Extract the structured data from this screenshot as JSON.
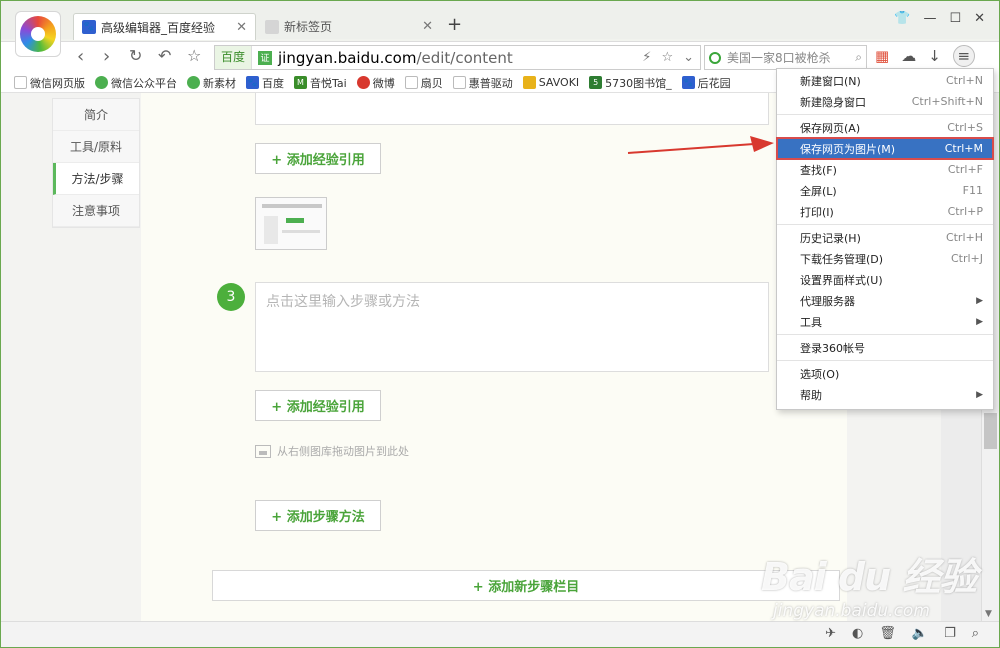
{
  "tabs": [
    {
      "title": "高级编辑器_百度经验",
      "active": true
    },
    {
      "title": "新标签页",
      "active": false
    }
  ],
  "address": {
    "tag": "百度",
    "badge": "证",
    "domain": "jingyan.baidu.com",
    "path": "/edit/content"
  },
  "search": {
    "text": "美国一家8口被枪杀"
  },
  "bookmarks": [
    {
      "label": "微信网页版",
      "icon": "page-icon",
      "color": "#bdbdbd"
    },
    {
      "label": "微信公众平台",
      "icon": "wechat-icon",
      "color": "#4caf50"
    },
    {
      "label": "新素材",
      "icon": "wechat-icon",
      "color": "#4caf50"
    },
    {
      "label": "百度",
      "icon": "baidu-paw-icon",
      "color": "#2f5fcf"
    },
    {
      "label": "音悦Tai",
      "icon": "yinyuetai-icon",
      "color": "#3a8d2a"
    },
    {
      "label": "微博",
      "icon": "weibo-icon",
      "color": "#d8382e"
    },
    {
      "label": "扇贝",
      "icon": "page-icon",
      "color": "#bdbdbd"
    },
    {
      "label": "惠普驱动",
      "icon": "page-icon",
      "color": "#bdbdbd"
    },
    {
      "label": "SAVOKI",
      "icon": "savoki-icon",
      "color": "#e8b21a"
    },
    {
      "label": "5730图书馆_",
      "icon": "five-icon",
      "color": "#2e7d32"
    },
    {
      "label": "后花园",
      "icon": "baidu-paw-icon",
      "color": "#2f5fcf"
    }
  ],
  "sidenav": [
    {
      "label": "简介",
      "active": false
    },
    {
      "label": "工具/原料",
      "active": false
    },
    {
      "label": "方法/步骤",
      "active": true
    },
    {
      "label": "注意事项",
      "active": false
    }
  ],
  "editor": {
    "add_reference_1": "+ 添加经验引用",
    "step_number": "3",
    "step_placeholder": "点击这里输入步骤或方法",
    "add_reference_2": "+ 添加经验引用",
    "drag_hint": "从右侧图库拖动图片到此处",
    "add_step_method": "+ 添加步骤方法",
    "add_new_section": "+ 添加新步骤栏目"
  },
  "menu": [
    {
      "label": "新建窗口(N)",
      "shortcut": "Ctrl+N"
    },
    {
      "label": "新建隐身窗口",
      "shortcut": "Ctrl+Shift+N"
    },
    {
      "sep": true
    },
    {
      "label": "保存网页(A)",
      "shortcut": "Ctrl+S"
    },
    {
      "label": "保存网页为图片(M)",
      "shortcut": "Ctrl+M",
      "highlight": true
    },
    {
      "label": "查找(F)",
      "shortcut": "Ctrl+F"
    },
    {
      "label": "全屏(L)",
      "shortcut": "F11"
    },
    {
      "label": "打印(I)",
      "shortcut": "Ctrl+P"
    },
    {
      "sep": true
    },
    {
      "label": "历史记录(H)",
      "shortcut": "Ctrl+H"
    },
    {
      "label": "下载任务管理(D)",
      "shortcut": "Ctrl+J"
    },
    {
      "label": "设置界面样式(U)",
      "shortcut": ""
    },
    {
      "label": "代理服务器",
      "shortcut": "",
      "submenu": true
    },
    {
      "label": "工具",
      "shortcut": "",
      "submenu": true
    },
    {
      "sep": true
    },
    {
      "label": "登录360帐号",
      "shortcut": ""
    },
    {
      "sep": true
    },
    {
      "label": "选项(O)",
      "shortcut": ""
    },
    {
      "label": "帮助",
      "shortcut": "",
      "submenu": true
    }
  ],
  "watermark": {
    "big": "Bai du 经验",
    "small": "jingyan.baidu.com"
  },
  "colors": {
    "accent_green": "#4caf3c",
    "menu_highlight": "#3872c2",
    "annotation_red": "#d8382e"
  }
}
